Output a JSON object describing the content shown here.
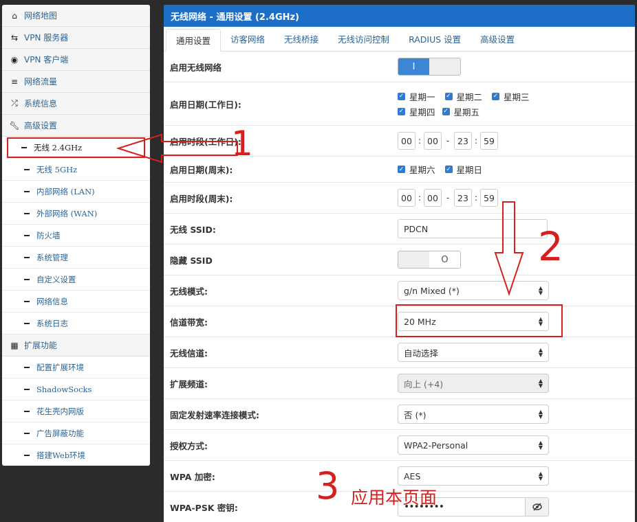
{
  "sidebar": {
    "items": [
      {
        "label": "网络地图",
        "icon": "home-icon"
      },
      {
        "label": "VPN 服务器",
        "icon": "retweet-icon"
      },
      {
        "label": "VPN 客户端",
        "icon": "globe-icon"
      },
      {
        "label": "网络流量",
        "icon": "list-icon"
      },
      {
        "label": "系统信息",
        "icon": "shuffle-icon"
      },
      {
        "label": "高级设置",
        "icon": "wrench-icon"
      }
    ],
    "advanced_subitems": [
      "无线 2.4GHz",
      "无线 5GHz",
      "内部网络 (LAN)",
      "外部网络 (WAN)",
      "防火墙",
      "系统管理",
      "自定义设置",
      "网络信息",
      "系统日志"
    ],
    "ext_label": "扩展功能",
    "ext_icon": "grid-icon",
    "ext_subitems": [
      "配置扩展环境",
      "ShadowSocks",
      "花生壳内网版",
      "广告屏蔽功能",
      "搭建Web环境"
    ]
  },
  "main": {
    "title": "无线网络 - 通用设置 (2.4GHz)",
    "tabs": [
      "通用设置",
      "访客网络",
      "无线桥接",
      "无线访问控制",
      "RADIUS 设置",
      "高级设置"
    ],
    "rows": {
      "enable_wireless": {
        "label": "启用无线网络",
        "toggle_text": "I"
      },
      "weekday_days": {
        "label": "启用日期(工作日):",
        "days": [
          "星期一",
          "星期二",
          "星期三",
          "星期四",
          "星期五"
        ]
      },
      "weekday_time": {
        "label": "启用时段(工作日):",
        "t1": "00",
        "t2": "00",
        "t3": "23",
        "t4": "59"
      },
      "weekend_days": {
        "label": "启用日期(周末):",
        "days": [
          "星期六",
          "星期日"
        ]
      },
      "weekend_time": {
        "label": "启用时段(周末):",
        "t1": "00",
        "t2": "00",
        "t3": "23",
        "t4": "59"
      },
      "ssid": {
        "label": "无线 SSID:",
        "value": "PDCN"
      },
      "hide_ssid": {
        "label": "隐藏 SSID",
        "toggle_text": "O"
      },
      "mode": {
        "label": "无线模式:",
        "value": "g/n Mixed (*)"
      },
      "bandwidth": {
        "label": "信道带宽:",
        "value": "20 MHz"
      },
      "channel": {
        "label": "无线信道:",
        "value": "自动选择"
      },
      "ext_channel": {
        "label": "扩展频道:",
        "value": "向上 (+4)"
      },
      "fixed_rate": {
        "label": "固定发射速率连接模式:",
        "value": "否 (*)"
      },
      "auth": {
        "label": "授权方式:",
        "value": "WPA2-Personal"
      },
      "wpa_enc": {
        "label": "WPA 加密:",
        "value": "AES"
      },
      "psk": {
        "label": "WPA-PSK 密钥:",
        "value": "••••••••"
      }
    }
  },
  "annotations": {
    "n1": "1",
    "n2": "2",
    "n3": "3",
    "apply_text": "应用本页面",
    "color": "#d62020"
  }
}
